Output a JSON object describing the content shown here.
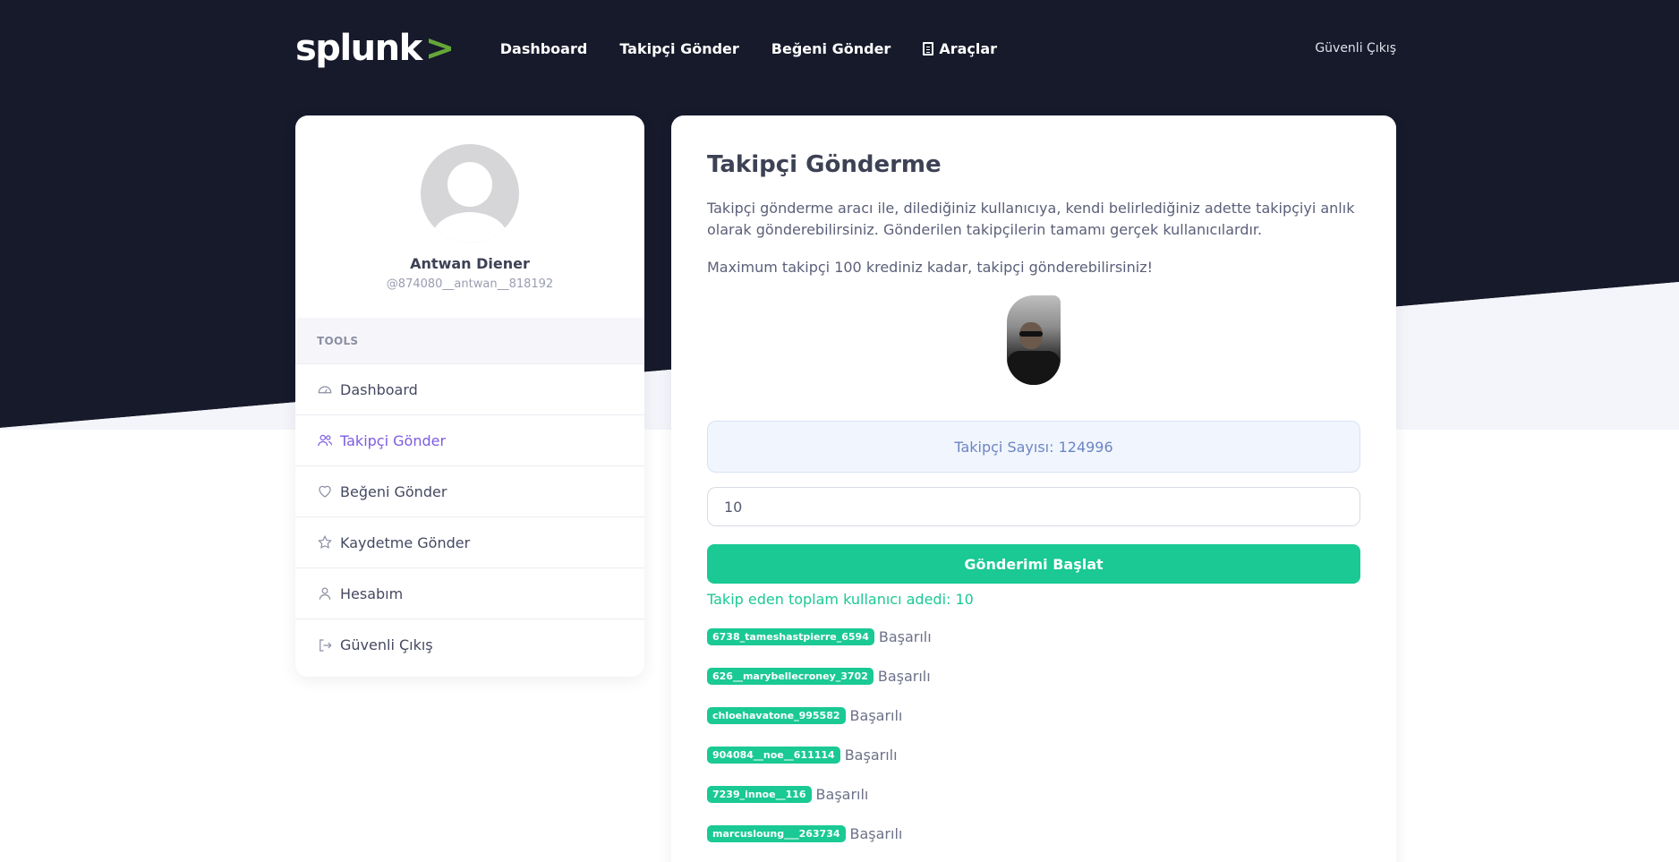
{
  "header": {
    "logo_text": "splunk",
    "logo_mark": ">",
    "nav": [
      {
        "label": "Dashboard"
      },
      {
        "label": "Takipçi Gönder"
      },
      {
        "label": "Beğeni Gönder"
      },
      {
        "label": "Araçlar",
        "icon": "document-icon"
      }
    ],
    "logout": "Güvenli Çıkış"
  },
  "sidebar": {
    "profile": {
      "name": "Antwan Diener",
      "username": "@874080__antwan__818192"
    },
    "section_label": "TOOLS",
    "items": [
      {
        "label": "Dashboard",
        "icon": "dashboard-icon"
      },
      {
        "label": "Takipçi Gönder",
        "icon": "users-icon",
        "active": true
      },
      {
        "label": "Beğeni Gönder",
        "icon": "heart-icon"
      },
      {
        "label": "Kaydetme Gönder",
        "icon": "star-icon"
      },
      {
        "label": "Hesabım",
        "icon": "user-icon"
      },
      {
        "label": "Güvenli Çıkış",
        "icon": "logout-icon"
      }
    ]
  },
  "main": {
    "title": "Takipçi Gönderme",
    "description": "Takipçi gönderme aracı ile, dilediğiniz kullanıcıya, kendi belirlediğiniz adette takipçiyi anlık olarak gönderebilirsiniz. Gönderilen takipçilerin tamamı gerçek kullanıcılardır.",
    "max_info": "Maximum takipçi 100 krediniz kadar, takipçi gönderebilirsiniz!",
    "follower_count": "Takipçi Sayısı: 124996",
    "quantity_value": "10",
    "start_button": "Gönderimi Başlat",
    "total_line": "Takip eden toplam kullanıcı adedi: 10",
    "results": [
      {
        "user": "6738_tameshastpierre_6594",
        "status": "Başarılı"
      },
      {
        "user": "626__marybellecroney_3702",
        "status": "Başarılı"
      },
      {
        "user": "chloehavatone_995582",
        "status": "Başarılı"
      },
      {
        "user": "904084__noe__611114",
        "status": "Başarılı"
      },
      {
        "user": "7239_innoe__116",
        "status": "Başarılı"
      },
      {
        "user": "marcusloung___263734",
        "status": "Başarılı"
      }
    ]
  },
  "colors": {
    "dark_bg": "#161a2b",
    "accent_green": "#1ac993",
    "active_purple": "#7c5ce0",
    "logo_green": "#65a637"
  }
}
